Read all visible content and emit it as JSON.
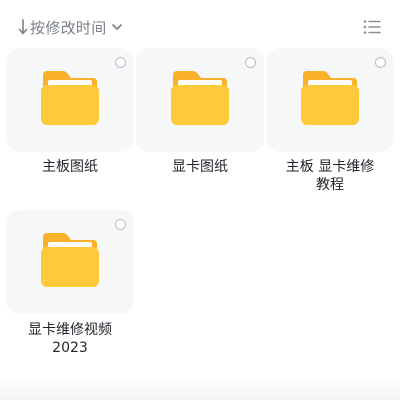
{
  "toolbar": {
    "sort_label": "按修改时间"
  },
  "folders": [
    {
      "line1": "主板图纸",
      "line2": ""
    },
    {
      "line1": "显卡图纸",
      "line2": ""
    },
    {
      "line1": "主板 显卡维修",
      "line2": "教程"
    },
    {
      "line1": "显卡维修视频",
      "line2": "2023"
    }
  ],
  "colors": {
    "folder_front": "#ffc93c",
    "folder_back": "#f9b02a",
    "tile_background": "#f6f7f9",
    "secondary_text": "#7a7f88"
  },
  "icons": {
    "sort": "arrow-down-icon",
    "dropdown": "chevron-down-icon",
    "view_toggle": "list-view-icon",
    "folder": "folder-icon",
    "select": "radio-circle-icon"
  }
}
